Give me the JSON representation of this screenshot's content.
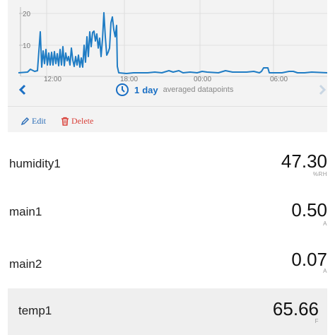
{
  "chart": {
    "y_ticks": [
      "20",
      "10"
    ],
    "x_ticks": [
      "12:00",
      "18:00",
      "00:00",
      "06:00"
    ],
    "line_color": "#1f7cc4"
  },
  "range": {
    "value": "1",
    "unit": "day",
    "sub": "averaged datapoints",
    "icon": "clock-icon"
  },
  "nav": {
    "prev_icon": "chevron-left-icon",
    "next_icon": "chevron-right-icon"
  },
  "actions": {
    "edit": "Edit",
    "delete": "Delete"
  },
  "readings": [
    {
      "name": "humidity1",
      "value": "47.30",
      "unit": "%RH"
    },
    {
      "name": "main1",
      "value": "0.50",
      "unit": "A"
    },
    {
      "name": "main2",
      "value": "0.07",
      "unit": "A"
    },
    {
      "name": "temp1",
      "value": "65.66",
      "unit": "F"
    }
  ],
  "colors": {
    "accent": "#1a6fc4",
    "delete": "#d9413a",
    "panel_bg": "#f3f3f3"
  }
}
